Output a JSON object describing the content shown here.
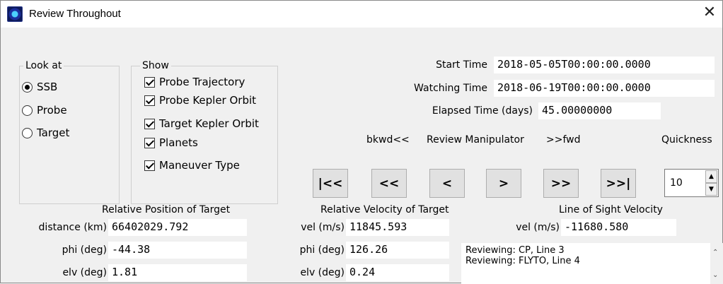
{
  "window": {
    "title": "Review Throughout",
    "close": "✕"
  },
  "look_at": {
    "legend": "Look at",
    "options": [
      {
        "label": "SSB",
        "selected": true
      },
      {
        "label": "Probe",
        "selected": false
      },
      {
        "label": "Target",
        "selected": false
      }
    ]
  },
  "show": {
    "legend": "Show",
    "items": [
      {
        "label": "Probe Trajectory",
        "checked": true
      },
      {
        "label": "Probe Kepler Orbit",
        "checked": true
      },
      {
        "label": "Target Kepler Orbit",
        "checked": true
      },
      {
        "label": "Planets",
        "checked": true
      },
      {
        "label": "Maneuver Type",
        "checked": true
      }
    ]
  },
  "times": {
    "start_label": "Start Time",
    "start_value": "2018-05-05T00:00:00.0000",
    "watching_label": "Watching Time",
    "watching_value": "2018-06-19T00:00:00.0000",
    "elapsed_label": "Elapsed Time (days)",
    "elapsed_value": "45.00000000"
  },
  "manipulator": {
    "bkwd_label": "bkwd<<",
    "center_label": "Review Manipulator",
    "fwd_label": ">>fwd",
    "quickness_label": "Quickness",
    "quickness_value": "10",
    "buttons": {
      "first": "|<<",
      "fast_back": "<<",
      "back": "<",
      "forward": ">",
      "fast_forward": ">>",
      "last": ">>|"
    }
  },
  "position": {
    "heading": "Relative Position of Target",
    "distance_label": "distance (km)",
    "distance_value": "66402029.792",
    "phi_label": "phi (deg)",
    "phi_value": "-44.38",
    "elv_label": "elv (deg)",
    "elv_value": "1.81"
  },
  "velocity": {
    "heading": "Relative Velocity of Target",
    "vel_label": "vel (m/s)",
    "vel_value": "11845.593",
    "phi_label": "phi (deg)",
    "phi_value": "126.26",
    "elv_label": "elv (deg)",
    "elv_value": "0.24"
  },
  "line_of_sight": {
    "heading": "Line of Sight Velocity",
    "vel_label": "vel (m/s)",
    "vel_value": "-11680.580"
  },
  "log": {
    "lines": [
      "Reviewing: CP, Line 3",
      "Reviewing: FLYTO, Line 4"
    ]
  }
}
